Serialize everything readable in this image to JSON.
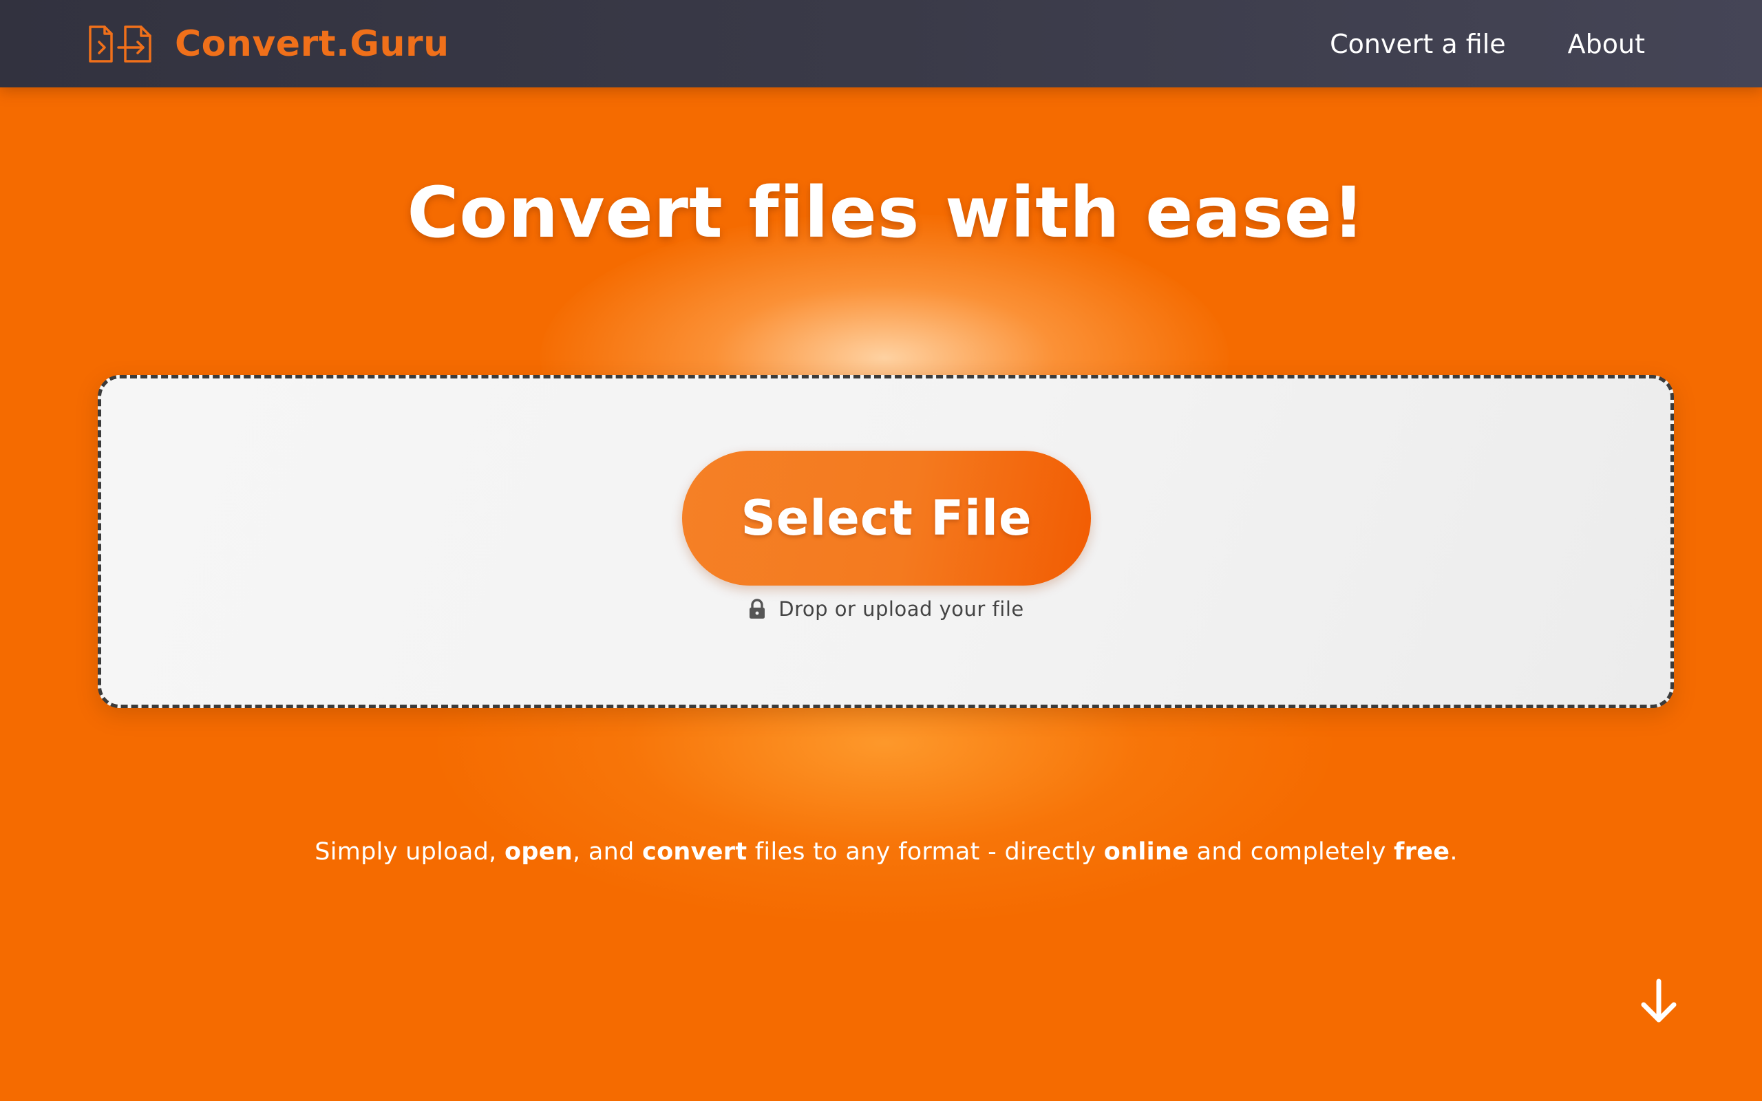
{
  "app": {
    "brand_name": "Convert.Guru",
    "brand_icon": "file-convert-icon",
    "brand_color": "#f0701a",
    "background_color": "#f56b00"
  },
  "nav": {
    "links": [
      {
        "label": "Convert a file"
      },
      {
        "label": "About"
      }
    ]
  },
  "hero": {
    "title": "Convert files with ease!"
  },
  "dropzone": {
    "button_label": "Select File",
    "hint": "Drop or upload your file",
    "hint_icon": "lock-icon"
  },
  "tagline": {
    "t1": "Simply upload, ",
    "b1": "open",
    "t2": ", and ",
    "b2": "convert",
    "t3": " files to any format - directly ",
    "b3": "online",
    "t4": " and completely ",
    "b4": "free",
    "t5": "."
  },
  "scroll": {
    "icon": "arrow-down-icon"
  }
}
